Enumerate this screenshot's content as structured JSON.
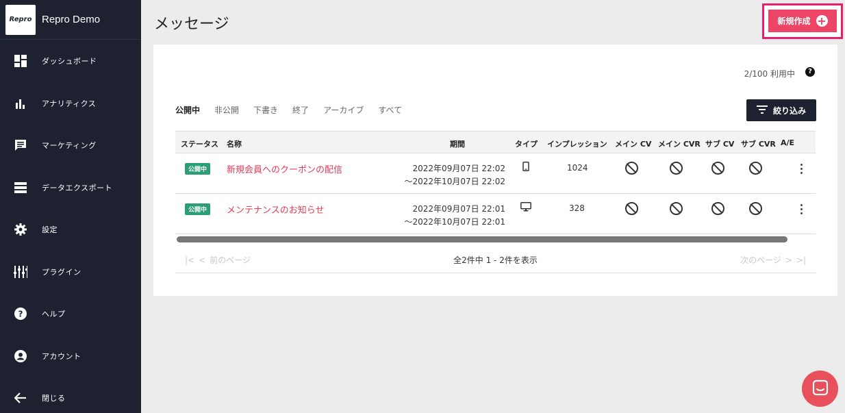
{
  "brand": {
    "logo_text": "Repro",
    "name": "Repro Demo"
  },
  "sidebar": {
    "items": [
      {
        "label": "ダッシュボード",
        "icon": "dashboard-icon"
      },
      {
        "label": "アナリティクス",
        "icon": "bar-chart-icon"
      },
      {
        "label": "マーケティング",
        "icon": "message-icon"
      },
      {
        "label": "データエクスポート",
        "icon": "list-icon"
      },
      {
        "label": "設定",
        "icon": "gear-icon"
      },
      {
        "label": "プラグイン",
        "icon": "equalizer-icon"
      },
      {
        "label": "ヘルプ",
        "icon": "help-icon"
      },
      {
        "label": "アカウント",
        "icon": "account-icon"
      },
      {
        "label": "閉じる",
        "icon": "arrow-left-icon"
      }
    ]
  },
  "header": {
    "title": "メッセージ",
    "create_label": "新規作成"
  },
  "usage": {
    "text": "2/100 利用中"
  },
  "tabs": [
    {
      "label": "公開中",
      "active": true
    },
    {
      "label": "非公開",
      "active": false
    },
    {
      "label": "下書き",
      "active": false
    },
    {
      "label": "終了",
      "active": false
    },
    {
      "label": "アーカイブ",
      "active": false
    },
    {
      "label": "すべて",
      "active": false
    }
  ],
  "filter": {
    "label": "絞り込み"
  },
  "table": {
    "columns": [
      "ステータス",
      "名称",
      "期間",
      "タイプ",
      "インプレッション",
      "メイン CV",
      "メイン CVR",
      "サブ CV",
      "サブ CVR",
      "A/E"
    ],
    "rows": [
      {
        "status": "公開中",
        "name": "新規会員へのクーポンの配信",
        "period_start": "2022年09月07日 22:02",
        "period_end": "〜2022年10月07日 22:02",
        "type": "mobile-icon",
        "impressions": "1024"
      },
      {
        "status": "公開中",
        "name": "メンテナンスのお知らせ",
        "period_start": "2022年09月07日 22:01",
        "period_end": "〜2022年10月07日 22:01",
        "type": "desktop-icon",
        "impressions": "328"
      }
    ]
  },
  "pager": {
    "prev_label": "前のページ",
    "info": "全2件中 1 - 2件を表示",
    "next_label": "次のページ"
  },
  "colors": {
    "sidebar_bg": "#1e2230",
    "accent": "#ec4565",
    "link": "#e83a56",
    "badge": "#2b9e78"
  }
}
